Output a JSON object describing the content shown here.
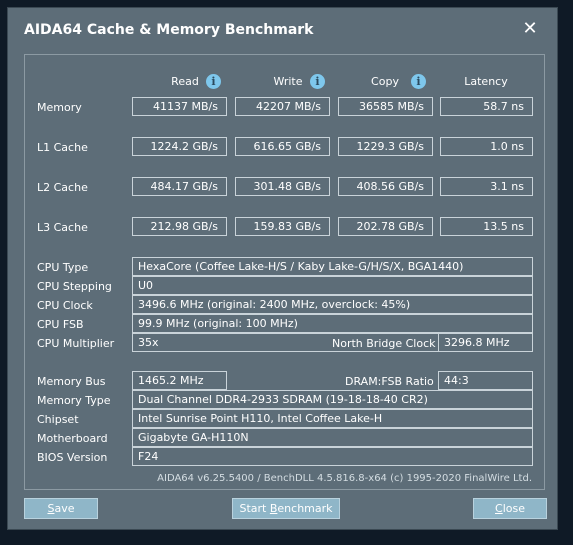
{
  "window": {
    "title": "AIDA64 Cache & Memory Benchmark",
    "close_glyph": "✕"
  },
  "columns": {
    "read": "Read",
    "write": "Write",
    "copy": "Copy",
    "latency": "Latency",
    "info_glyph": "i"
  },
  "bench_rows": [
    {
      "label": "Memory",
      "read": "41137 MB/s",
      "write": "42207 MB/s",
      "copy": "36585 MB/s",
      "latency": "58.7 ns"
    },
    {
      "label": "L1 Cache",
      "read": "1224.2 GB/s",
      "write": "616.65 GB/s",
      "copy": "1229.3 GB/s",
      "latency": "1.0 ns"
    },
    {
      "label": "L2 Cache",
      "read": "484.17 GB/s",
      "write": "301.48 GB/s",
      "copy": "408.56 GB/s",
      "latency": "3.1 ns"
    },
    {
      "label": "L3 Cache",
      "read": "212.98 GB/s",
      "write": "159.83 GB/s",
      "copy": "202.78 GB/s",
      "latency": "13.5 ns"
    }
  ],
  "cpu": {
    "type_label": "CPU Type",
    "type_value": "HexaCore   (Coffee Lake-H/S / Kaby Lake-G/H/S/X, BGA1440)",
    "stepping_label": "CPU Stepping",
    "stepping_value": "U0",
    "clock_label": "CPU Clock",
    "clock_value": "3496.6 MHz  (original: 2400 MHz, overclock: 45%)",
    "fsb_label": "CPU FSB",
    "fsb_value": "99.9 MHz  (original: 100 MHz)",
    "multiplier_label": "CPU Multiplier",
    "multiplier_value": "35x",
    "nb_clock_label": "North Bridge Clock",
    "nb_clock_value": "3296.8 MHz"
  },
  "memory": {
    "bus_label": "Memory Bus",
    "bus_value": "1465.2 MHz",
    "ratio_label": "DRAM:FSB Ratio",
    "ratio_value": "44:3",
    "type_label": "Memory Type",
    "type_value": "Dual Channel DDR4-2933 SDRAM  (19-18-18-40 CR2)",
    "chipset_label": "Chipset",
    "chipset_value": "Intel Sunrise Point H110, Intel Coffee Lake-H",
    "motherboard_label": "Motherboard",
    "motherboard_value": "Gigabyte GA-H110N",
    "bios_label": "BIOS Version",
    "bios_value": "F24"
  },
  "footer": "AIDA64 v6.25.5400 / BenchDLL 4.5.816.8-x64  (c) 1995-2020 FinalWire Ltd.",
  "buttons": {
    "save_first": "S",
    "save_rest": "ave",
    "start_pre": "Start ",
    "start_u": "B",
    "start_post": "enchmark",
    "close_first": "C",
    "close_rest": "lose"
  },
  "colors": {
    "window_bg": "#5d6d78",
    "button_bg": "#8fb6c8",
    "info_icon": "#7ec7ec"
  }
}
